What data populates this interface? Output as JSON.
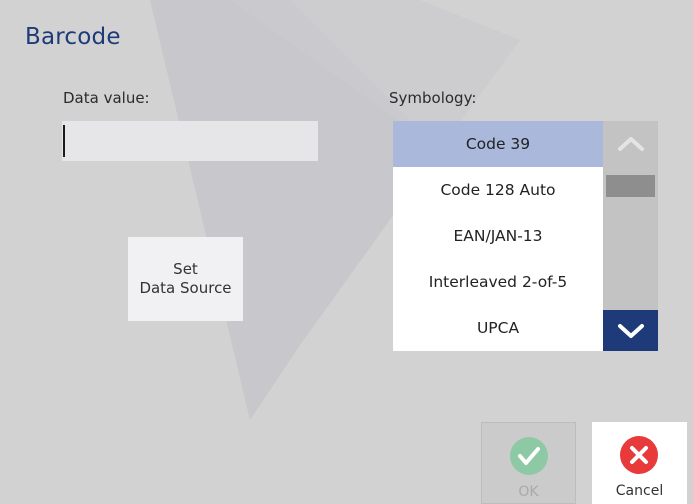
{
  "dialog": {
    "title": "Barcode"
  },
  "data_value": {
    "label": "Data value:",
    "value": ""
  },
  "set_source": {
    "line1": "Set",
    "line2": "Data Source"
  },
  "symbology": {
    "label": "Symbology:",
    "selected": "Code 39",
    "options": [
      "Code 39",
      "Code 128 Auto",
      "EAN/JAN-13",
      "Interleaved 2-of-5",
      "UPCA"
    ]
  },
  "icons": {
    "scroll_up": "chevron-up-icon",
    "scroll_down": "chevron-down-icon",
    "ok": "check-icon",
    "cancel": "close-icon"
  },
  "actions": {
    "ok_label": "OK",
    "cancel_label": "Cancel"
  },
  "colors": {
    "accent": "#1e3a78",
    "selected_row": "#aab8dc",
    "ok_green": "#8ec9a5",
    "cancel_red": "#e83a3a",
    "background": "#d2d2d2"
  }
}
